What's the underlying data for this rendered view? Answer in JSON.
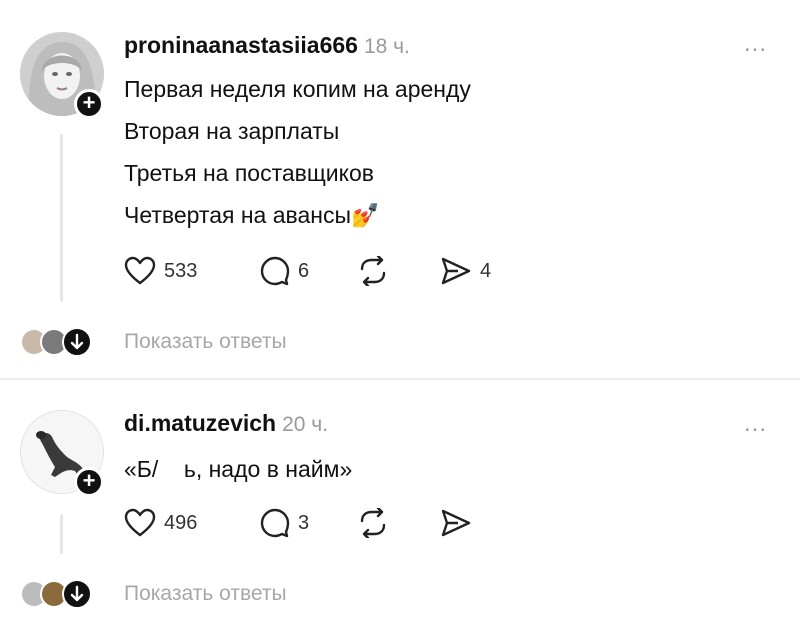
{
  "posts": [
    {
      "username": "proninaanastasiia666",
      "time": "18 ч.",
      "more": "...",
      "lines": [
        "Первая неделя копим на аренду",
        "Вторая на зарплаты",
        "Третья на поставщиков",
        "Четвертая на авансы"
      ],
      "emoji": "💅",
      "likes": "533",
      "comments": "6",
      "shares": "4",
      "show_replies": "Показать ответы"
    },
    {
      "username": "di.matuzevich",
      "time": "20 ч.",
      "more": "...",
      "lines": [
        "«Б/    ь, надо в найм»"
      ],
      "likes": "496",
      "comments": "3",
      "show_replies": "Показать ответы"
    }
  ]
}
